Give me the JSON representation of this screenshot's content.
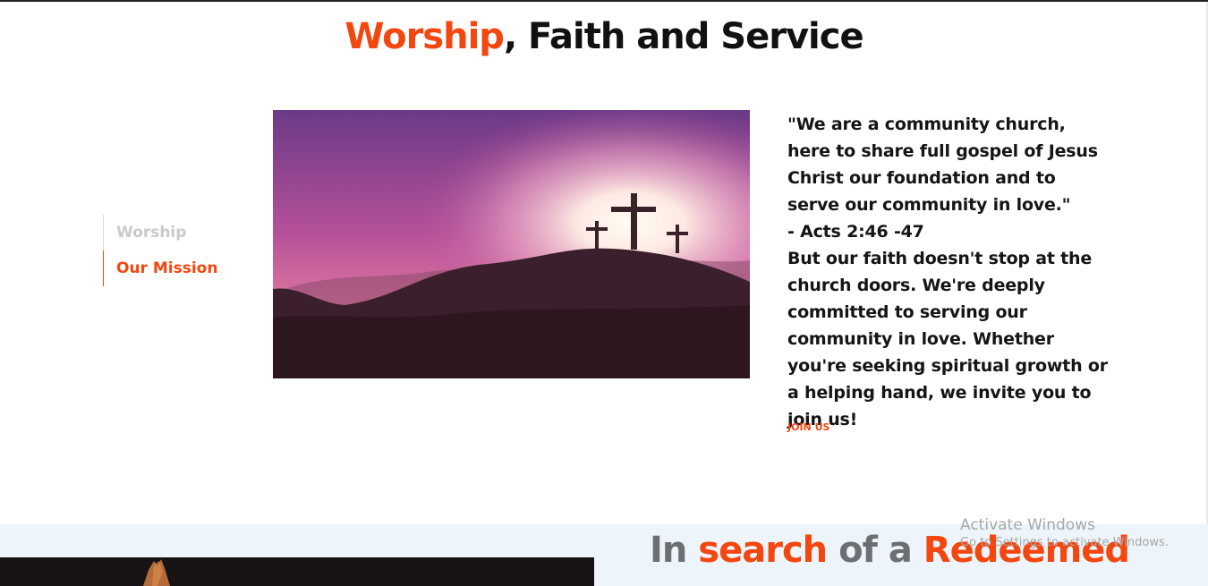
{
  "headline": {
    "accent": "Worship",
    "rest": ", Faith and Service"
  },
  "tabs": [
    {
      "label": "Worship",
      "active": false
    },
    {
      "label": "Our Mission",
      "active": true
    }
  ],
  "quote": {
    "lines": [
      "\"We are a community church, here to share full gospel of Jesus Christ our foundation and to serve our community in love.\"",
      "- Acts 2:46 -47",
      "But our faith doesn't stop at the church doors. We're deeply committed to serving our community in love. Whether you're seeking spiritual growth or a helping hand, we invite you to join us!"
    ]
  },
  "cta": {
    "label": "JOIN US"
  },
  "section2": {
    "title_parts": [
      {
        "text": "In ",
        "accent": false
      },
      {
        "text": "search",
        "accent": true
      },
      {
        "text": " of a ",
        "accent": false
      },
      {
        "text": "Redeemed",
        "accent": true
      }
    ]
  },
  "watermark": {
    "line1": "Activate Windows",
    "line2": "Go to Settings to activate Windows."
  },
  "colors": {
    "accent": "#f4460f",
    "text": "#111111",
    "muted_tab": "#c9c9c9",
    "band_bg": "#eef5fa"
  },
  "icons": {
    "hero": "three-crosses-image",
    "band": "raised-hands-image"
  }
}
